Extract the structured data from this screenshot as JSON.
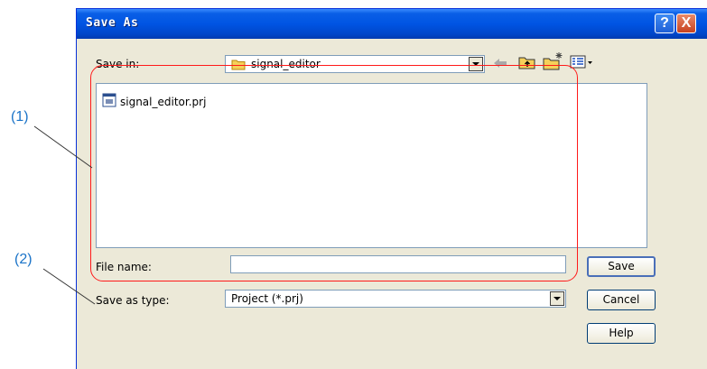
{
  "callouts": {
    "c1": "(1)",
    "c2": "(2)"
  },
  "dialog": {
    "title": "Save As",
    "help_btn": "?",
    "close_btn": "X",
    "save_in_label": "Save in:",
    "save_in_value": "signal_editor",
    "files": [
      {
        "name": "signal_editor.prj",
        "icon": "project-file-icon"
      }
    ],
    "file_name_label": "File name:",
    "file_name_value": "",
    "save_as_type_label": "Save as type:",
    "save_as_type_value": "Project (*.prj)",
    "buttons": {
      "save": "Save",
      "cancel": "Cancel",
      "help": "Help"
    }
  },
  "toolbar_icons": [
    "back-arrow-icon",
    "up-folder-icon",
    "new-folder-icon",
    "view-menu-icon"
  ],
  "colors": {
    "accent": "#0054e3",
    "callout": "#1a73c8",
    "highlight": "#ff1a1a",
    "dialog_bg": "#ece9d8"
  }
}
